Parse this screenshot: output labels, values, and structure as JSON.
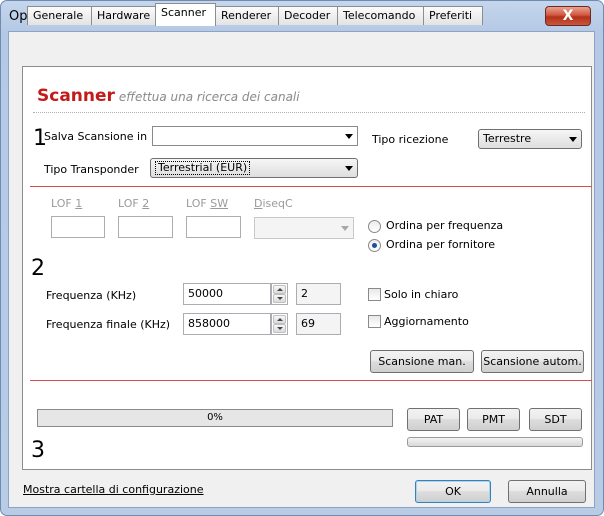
{
  "window": {
    "title": "Opzioni",
    "close_label": "X"
  },
  "tabs": [
    {
      "label": "Generale",
      "active": false
    },
    {
      "label": "Hardware",
      "active": false
    },
    {
      "label": "Scanner",
      "active": true
    },
    {
      "label": "Renderer",
      "active": false
    },
    {
      "label": "Decoder",
      "active": false
    },
    {
      "label": "Telecomando",
      "active": false
    },
    {
      "label": "Preferiti",
      "active": false
    }
  ],
  "header": {
    "title": "Scanner",
    "subtitle": "effettua una ricerca dei canali"
  },
  "section_numbers": [
    "1",
    "2",
    "3"
  ],
  "section1": {
    "salva_label": "Salva Scansione in",
    "salva_value": "",
    "tipo_transponder_label": "Tipo Transponder",
    "tipo_transponder_value": "Terrestrial (EUR)",
    "tipo_ricezione_label": "Tipo ricezione",
    "tipo_ricezione_value": "Terrestre"
  },
  "section2": {
    "lof1_label": "LOF 1",
    "lof2_label": "LOF 2",
    "lofsw_label": "LOF SW",
    "diseqc_label": "DiseqC",
    "sort_frequency_label": "Ordina per frequenza",
    "sort_provider_label": "Ordina per fornitore",
    "sort_selected": "provider",
    "frequenza_label": "Frequenza (KHz)",
    "frequenza_value": "50000",
    "frequenza_channel": "2",
    "frequenza_finale_label": "Frequenza finale (KHz)",
    "frequenza_finale_value": "858000",
    "frequenza_finale_channel": "69",
    "solo_in_chiaro_label": "Solo in chiaro",
    "solo_in_chiaro_checked": false,
    "aggiornamento_label": "Aggiornamento",
    "aggiornamento_checked": false,
    "scan_manual_label": "Scansione man.",
    "scan_auto_label": "Scansione autom."
  },
  "section3": {
    "progress_text": "0%",
    "progress_value": 0,
    "pat_label": "PAT",
    "pmt_label": "PMT",
    "sdt_label": "SDT"
  },
  "footer": {
    "config_link": "Mostra cartella di configurazione",
    "ok_label": "OK",
    "cancel_label": "Annulla"
  },
  "colors": {
    "accent_red": "#c41a1a",
    "divider_red": "#d84c4c",
    "radio_dot": "#1b4fa0"
  }
}
